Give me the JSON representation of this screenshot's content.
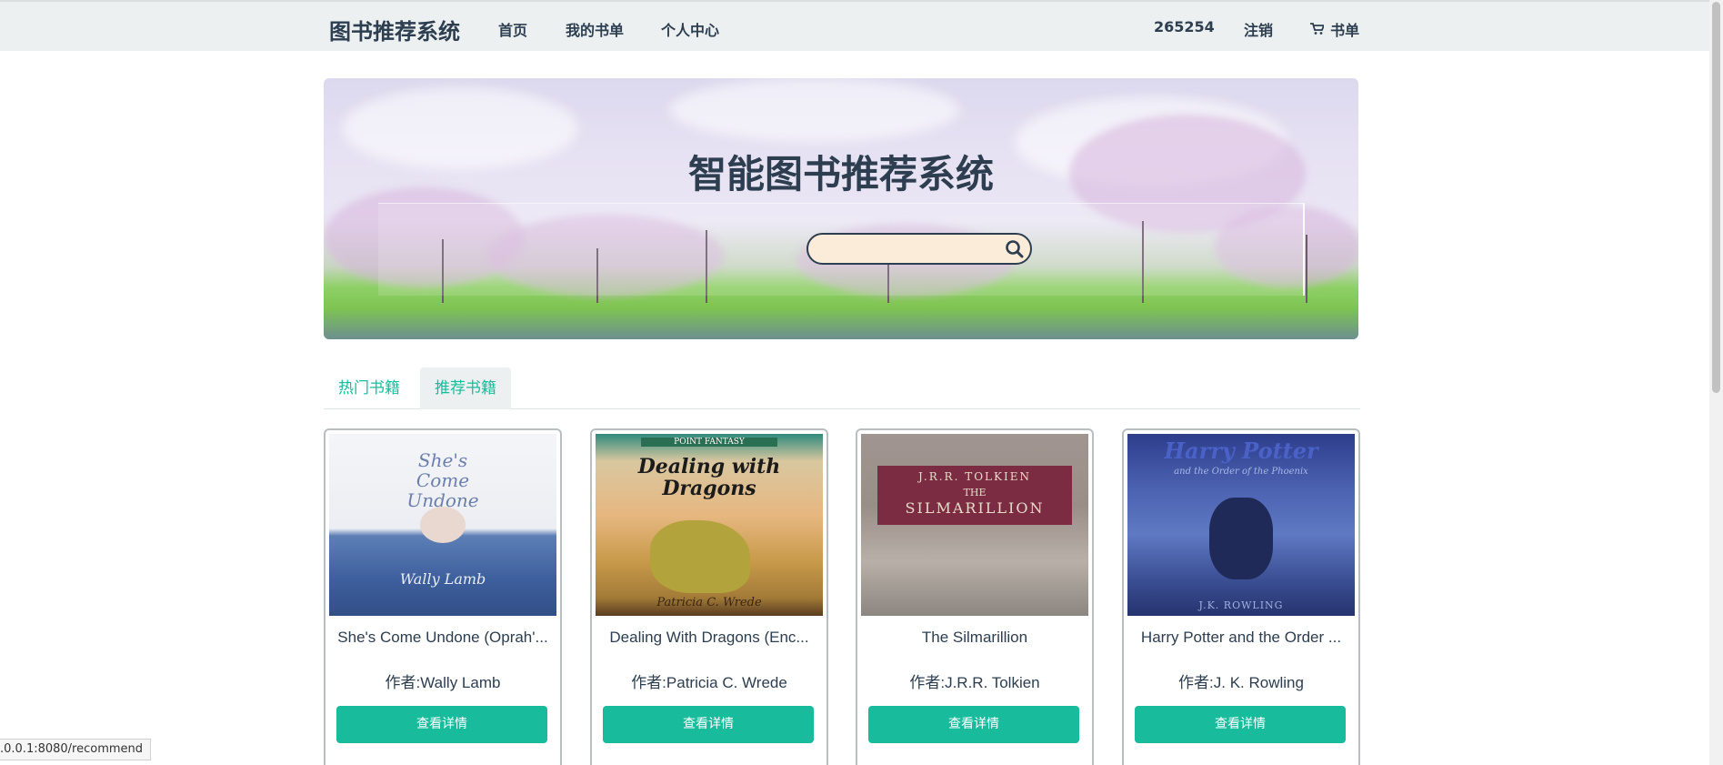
{
  "navbar": {
    "brand": "图书推荐系统",
    "links": [
      "首页",
      "我的书单",
      "个人中心"
    ],
    "user_id": "265254",
    "logout": "注销",
    "cart_label": "书单"
  },
  "hero": {
    "title": "智能图书推荐系统",
    "search_value": "",
    "search_placeholder": ""
  },
  "tabs": [
    {
      "label": "热门书籍",
      "active": false
    },
    {
      "label": "推荐书籍",
      "active": true
    }
  ],
  "books": [
    {
      "title": "She's Come Undone (Oprah'...",
      "author": "作者:Wally Lamb",
      "button": "查看详情",
      "cover_text": [
        "She's",
        "Come",
        "Undone",
        "Wally Lamb"
      ]
    },
    {
      "title": "Dealing With Dragons (Enc...",
      "author": "作者:Patricia C. Wrede",
      "button": "查看详情",
      "cover_text": [
        "POINT FANTASY",
        "Dealing with",
        "Dragons",
        "Patricia C. Wrede"
      ]
    },
    {
      "title": "The Silmarillion",
      "author": "作者:J.R.R. Tolkien",
      "button": "查看详情",
      "cover_text": [
        "J.R.R. TOLKIEN",
        "THE",
        "SILMARILLION"
      ]
    },
    {
      "title": "Harry Potter and the Order ...",
      "author": "作者:J. K. Rowling",
      "button": "查看详情",
      "cover_text": [
        "Harry Potter",
        "and the Order of the Phoenix",
        "J.K. ROWLING"
      ]
    }
  ],
  "statusbar": {
    "url": ".0.0.1:8080/recommend"
  },
  "colors": {
    "accent": "#18bc9c",
    "navbar": "#ecf0f1",
    "text": "#2c3e50"
  }
}
